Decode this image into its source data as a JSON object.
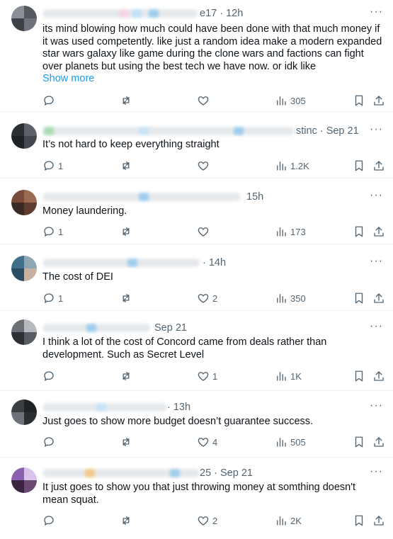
{
  "replies": [
    {
      "meta": "e17 · 12h",
      "text": "its mind blowing how much could have been done with that much money if it was used competently. like just a random idea make a modern expanded star wars galaxy like game during the clone wars and factions can fight over planets but using the best tech we have now. or idk like",
      "show_more": "Show more",
      "stats": {
        "replies": "",
        "reposts": "",
        "likes": "",
        "views": "305"
      }
    },
    {
      "meta": "stinc · Sep 21",
      "text": "It’s not hard to keep everything straight",
      "stats": {
        "replies": "1",
        "reposts": "",
        "likes": "",
        "views": "1.2K"
      }
    },
    {
      "meta": "15h",
      "text": "Money laundering.",
      "stats": {
        "replies": "1",
        "reposts": "",
        "likes": "",
        "views": "173"
      }
    },
    {
      "meta": "· 14h",
      "text": "The cost of DEI",
      "stats": {
        "replies": "1",
        "reposts": "",
        "likes": "2",
        "views": "350"
      }
    },
    {
      "meta": "Sep 21",
      "text": "I think a lot of the cost of Concord came from deals rather than development. Such as Secret Level",
      "stats": {
        "replies": "",
        "reposts": "",
        "likes": "1",
        "views": "1K"
      }
    },
    {
      "meta": "· 13h",
      "text": "Just goes to show more budget doesn’t guarantee success.",
      "stats": {
        "replies": "",
        "reposts": "",
        "likes": "4",
        "views": "505"
      }
    },
    {
      "meta": "25 · Sep 21",
      "text": "It just goes to show you that just throwing money at somthing doesn't mean squat.",
      "stats": {
        "replies": "",
        "reposts": "",
        "likes": "2",
        "views": "2K"
      }
    }
  ],
  "more_label": "···",
  "colors": {
    "text": "#0f1419",
    "muted": "#536471",
    "link": "#1d9bf0",
    "divider": "#eff3f4"
  },
  "icons": [
    "reply-icon",
    "repost-icon",
    "like-icon",
    "views-icon",
    "bookmark-icon",
    "share-icon",
    "more-icon"
  ]
}
